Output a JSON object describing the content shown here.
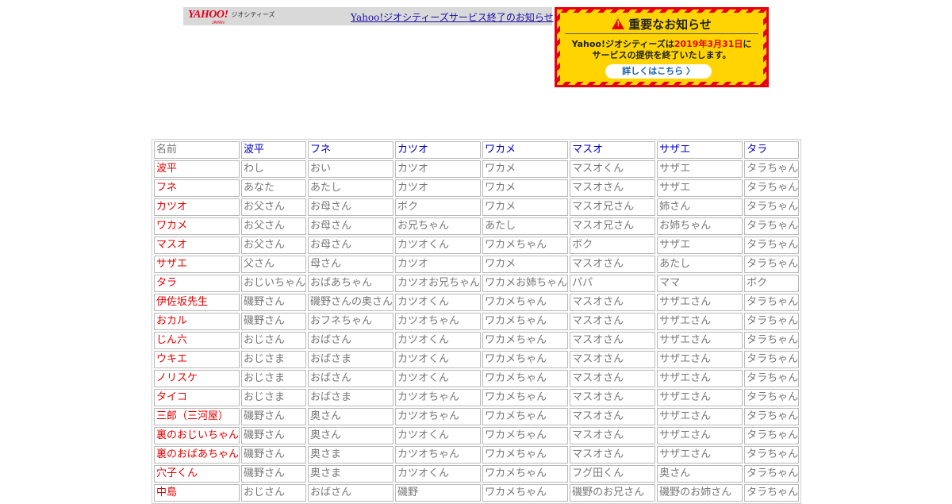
{
  "geocities": {
    "logo_yahoo": "YAHOO!",
    "logo_japan": "JAPAN",
    "logo_service": "ジオシティーズ",
    "end_link": "Yahoo!ジオシティーズサービス終了のお知らせ"
  },
  "notice": {
    "title": "重要なお知らせ",
    "line1_prefix": "Yahoo!ジオシティーズは",
    "line1_date": "2019年3月31日",
    "line1_suffix": "に",
    "line2": "サービスの提供を終了いたします。",
    "button": "詳しくはこちら 〉",
    "colors": {
      "red": "#e60012",
      "yellow": "#ffd400"
    }
  },
  "table": {
    "corner": "名前",
    "columns": [
      "波平",
      "フネ",
      "カツオ",
      "ワカメ",
      "マスオ",
      "サザエ",
      "タラ"
    ],
    "rows": [
      {
        "name": "波平",
        "cells": [
          "わし",
          "おい",
          "カツオ",
          "ワカメ",
          "マスオくん",
          "サザエ",
          "タラちゃん"
        ]
      },
      {
        "name": "フネ",
        "cells": [
          "あなた",
          "あたし",
          "カツオ",
          "ワカメ",
          "マスオさん",
          "サザエ",
          "タラちゃん"
        ]
      },
      {
        "name": "カツオ",
        "cells": [
          "お父さん",
          "お母さん",
          "ボク",
          "ワカメ",
          "マスオ兄さん",
          "姉さん",
          "タラちゃん"
        ]
      },
      {
        "name": "ワカメ",
        "cells": [
          "お父さん",
          "お母さん",
          "お兄ちゃん",
          "あたし",
          "マスオ兄さん",
          "お姉ちゃん",
          "タラちゃん"
        ]
      },
      {
        "name": "マスオ",
        "cells": [
          "お父さん",
          "お母さん",
          "カツオくん",
          "ワカメちゃん",
          "ボク",
          "サザエ",
          "タラちゃん"
        ]
      },
      {
        "name": "サザエ",
        "cells": [
          "父さん",
          "母さん",
          "カツオ",
          "ワカメ",
          "マスオさん",
          "あたし",
          "タラちゃん"
        ]
      },
      {
        "name": "タラ",
        "cells": [
          "おじいちゃん",
          "おばあちゃん",
          "カツオお兄ちゃん",
          "ワカメお姉ちゃん",
          "パパ",
          "ママ",
          "ボク"
        ]
      },
      {
        "name": "伊佐坂先生",
        "cells": [
          "磯野さん",
          "磯野さんの奥さん",
          "カツオくん",
          "ワカメちゃん",
          "マスオさん",
          "サザエさん",
          "タラちゃん"
        ]
      },
      {
        "name": "おカル",
        "cells": [
          "磯野さん",
          "おフネちゃん",
          "カツオちゃん",
          "ワカメちゃん",
          "マスオさん",
          "サザエさん",
          "タラちゃん"
        ]
      },
      {
        "name": "じん六",
        "cells": [
          "おじさん",
          "おばさん",
          "カツオくん",
          "ワカメちゃん",
          "マスオさん",
          "サザエさん",
          "タラちゃん"
        ]
      },
      {
        "name": "ウキエ",
        "cells": [
          "おじさま",
          "おばさま",
          "カツオくん",
          "ワカメちゃん",
          "マスオさん",
          "サザエさん",
          "タラちゃん"
        ]
      },
      {
        "name": "ノリスケ",
        "cells": [
          "おじさま",
          "おばさん",
          "カツオくん",
          "ワカメちゃん",
          "マスオさん",
          "サザエさん",
          "タラちゃん"
        ]
      },
      {
        "name": "タイコ",
        "cells": [
          "おじさま",
          "おばさま",
          "カツオちゃん",
          "ワカメちゃん",
          "マスオさん",
          "サザエさん",
          "タラちゃん"
        ]
      },
      {
        "name": "三郎（三河屋）",
        "cells": [
          "磯野さん",
          "奥さん",
          "カツオちゃん",
          "ワカメちゃん",
          "マスオさん",
          "サザエさん",
          "タラちゃん"
        ]
      },
      {
        "name": "裏のおじいちゃん",
        "cells": [
          "磯野さん",
          "奥さん",
          "カツオくん",
          "ワカメちゃん",
          "マスオさん",
          "サザエさん",
          "タラちゃん"
        ]
      },
      {
        "name": "裏のおばあちゃん",
        "cells": [
          "磯野さん",
          "奥さま",
          "カツオちゃん",
          "ワカメちゃん",
          "マスオさん",
          "サザエさん",
          "タラちゃん"
        ]
      },
      {
        "name": "穴子くん",
        "cells": [
          "磯野さん",
          "奥さま",
          "カツオくん",
          "ワカメちゃん",
          "フグ田くん",
          "奥さん",
          "タラちゃん"
        ]
      },
      {
        "name": "中島",
        "cells": [
          "おじさん",
          "おばさん",
          "磯野",
          "ワカメちゃん",
          "磯野のお兄さん",
          "磯野のお姉さん",
          "タラちゃん"
        ]
      }
    ]
  }
}
